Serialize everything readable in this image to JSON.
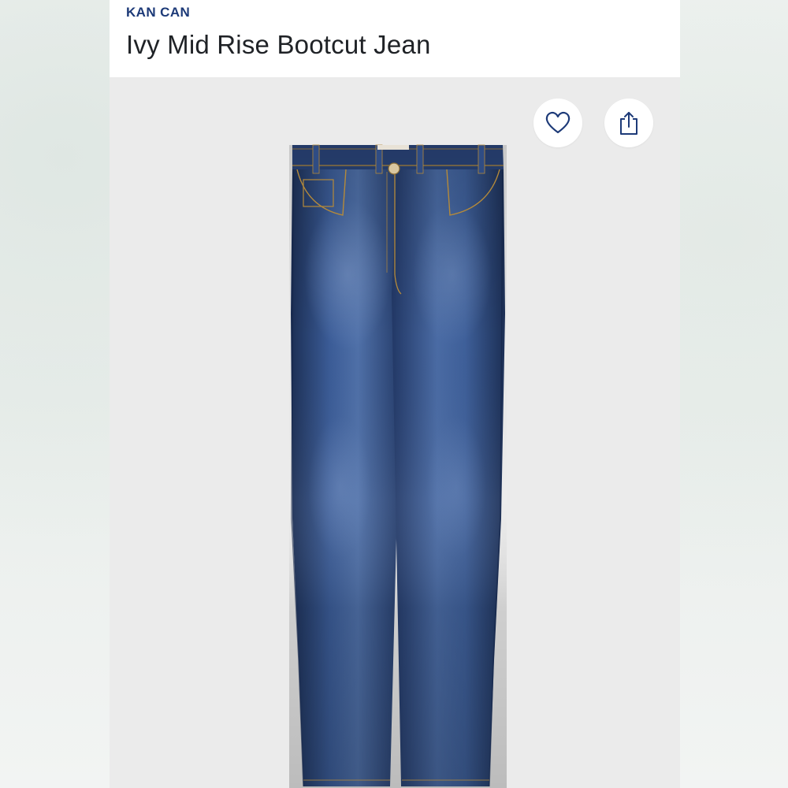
{
  "product": {
    "brand": "KAN CAN",
    "name": "Ivy Mid Rise Bootcut Jean"
  },
  "actions": {
    "favorite_icon": "heart-icon",
    "share_icon": "share-icon"
  },
  "colors": {
    "brand": "#1d3a78",
    "title": "#1f2226",
    "denim_dark": "#1e3157",
    "denim_mid": "#3a5a92",
    "denim_light": "#5f7fb3",
    "stitch": "#b58a3a",
    "image_bg": "#ebebeb"
  }
}
